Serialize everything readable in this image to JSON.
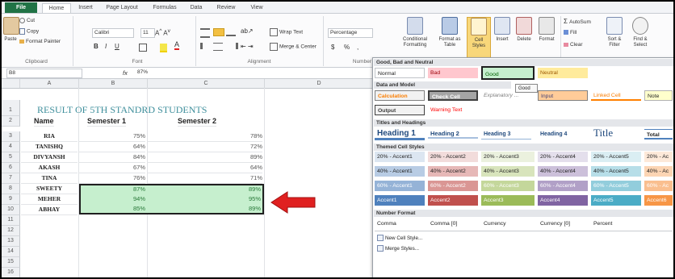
{
  "tabs": [
    "File",
    "Home",
    "Insert",
    "Page Layout",
    "Formulas",
    "Data",
    "Review",
    "View"
  ],
  "ribbon": {
    "clipboard": {
      "paste": "Paste",
      "cut": "Cut",
      "copy": "Copy",
      "format_painter": "Format Painter",
      "label": "Clipboard"
    },
    "font": {
      "name": "Calibri",
      "size": "11",
      "label": "Font",
      "bold": "B",
      "italic": "I",
      "underline": "U"
    },
    "alignment": {
      "wrap": "Wrap Text",
      "merge": "Merge & Center",
      "label": "Alignment"
    },
    "number": {
      "format": "Percentage",
      "currency": "$",
      "percent": "%",
      "comma": ",",
      "label": "Number"
    },
    "styles": {
      "conditional": "Conditional Formatting",
      "format_table": "Format as Table",
      "cell_styles": "Cell Styles"
    },
    "cells": {
      "insert": "Insert",
      "delete": "Delete",
      "format": "Format"
    },
    "editing": {
      "autosum": "AutoSum",
      "fill": "Fill",
      "clear": "Clear",
      "sort": "Sort & Filter",
      "find": "Find & Select"
    }
  },
  "formula_bar": {
    "name_box": "B8",
    "fx": "fx",
    "value": "87%"
  },
  "columns": [
    "A",
    "B",
    "C",
    "D"
  ],
  "rows": [
    "1",
    "2",
    "3",
    "4",
    "5",
    "6",
    "7",
    "8",
    "9",
    "10",
    "11",
    "12",
    "13",
    "14",
    "15",
    "16"
  ],
  "sheet": {
    "title": "RESULT OF 5TH STANDRD STUDENTS",
    "headers": {
      "name": "Name",
      "sem1": "Semester 1",
      "sem2": "Semester 2"
    },
    "students": [
      {
        "name": "RIA",
        "sem1": "75%",
        "sem2": "78%"
      },
      {
        "name": "TANISHQ",
        "sem1": "64%",
        "sem2": "72%"
      },
      {
        "name": "DIVYANSH",
        "sem1": "84%",
        "sem2": "89%"
      },
      {
        "name": "AKASH",
        "sem1": "67%",
        "sem2": "64%"
      },
      {
        "name": "TINA",
        "sem1": "76%",
        "sem2": "71%"
      },
      {
        "name": "SWEETY",
        "sem1": "87%",
        "sem2": "89%"
      },
      {
        "name": "MEHER",
        "sem1": "94%",
        "sem2": "95%"
      },
      {
        "name": "ABHAY",
        "sem1": "85%",
        "sem2": "89%"
      }
    ]
  },
  "gallery": {
    "sec_good_bad": "Good, Bad and Neutral",
    "normal": "Normal",
    "bad": "Bad",
    "good": "Good",
    "neutral": "Neutral",
    "tooltip": "Good",
    "sec_data_model": "Data and Model",
    "calculation": "Calculation",
    "check_cell": "Check Cell",
    "explanatory": "Explanatory ...",
    "input": "Input",
    "linked_cell": "Linked Cell",
    "note": "Note",
    "output": "Output",
    "warning": "Warning Text",
    "sec_titles": "Titles and Headings",
    "heading1": "Heading 1",
    "heading2": "Heading 2",
    "heading3": "Heading 3",
    "heading4": "Heading 4",
    "title": "Title",
    "total": "Total",
    "sec_themed": "Themed Cell Styles",
    "accent20": [
      "20% - Accent1",
      "20% - Accent2",
      "20% - Accent3",
      "20% - Accent4",
      "20% - Accent5",
      "20% - Ac"
    ],
    "accent40": [
      "40% - Accent1",
      "40% - Accent2",
      "40% - Accent3",
      "40% - Accent4",
      "40% - Accent5",
      "40% - Ac"
    ],
    "accent60": [
      "60% - Accent1",
      "60% - Accent2",
      "60% - Accent3",
      "60% - Accent4",
      "60% - Accent5",
      "60% - Ac"
    ],
    "accent": [
      "Accent1",
      "Accent2",
      "Accent3",
      "Accent4",
      "Accent5",
      "Accent6"
    ],
    "sec_number": "Number Format",
    "number_formats": [
      "Comma",
      "Comma [0]",
      "Currency",
      "Currency [0]",
      "Percent"
    ],
    "new_style": "New Cell Style...",
    "merge_styles": "Merge Styles..."
  },
  "colors": {
    "excel_green": "#217346",
    "highlight_green": "#c6efce",
    "good_text": "#006100",
    "bad_fill": "#ffc7ce",
    "neutral_fill": "#ffeb9c",
    "arrow": "#e02020",
    "title_teal": "#3f8f9c"
  }
}
